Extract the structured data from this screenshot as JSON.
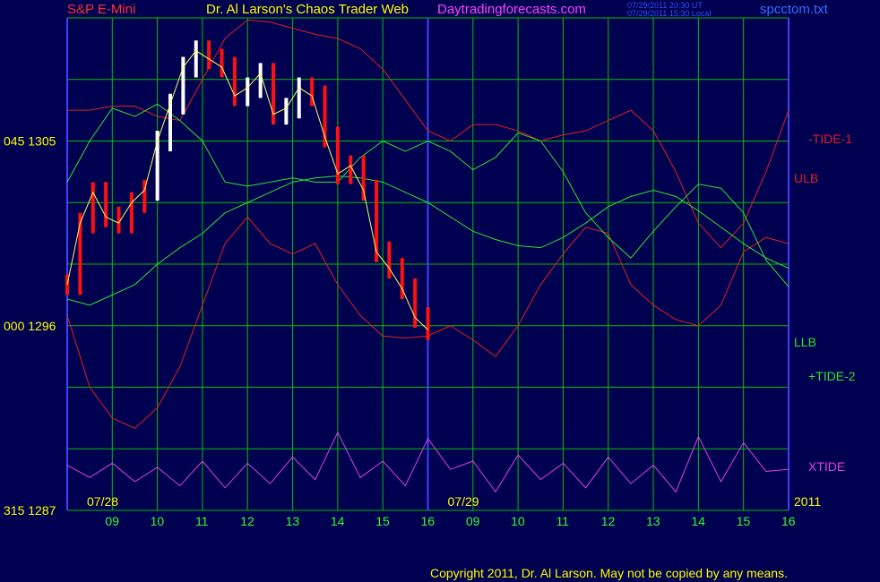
{
  "header": {
    "title": "S&P E-Mini",
    "subtitle": "Dr. Al Larson's Chaos Trader Web",
    "site": "Daytradingforecasts.com",
    "stamp_utc": "07/29/2011 20:30 UT",
    "stamp_local": "07/29/2011 15:30 Local",
    "file": "spcctom.txt"
  },
  "footer": {
    "copyright": "Copyright 2011, Dr. Al Larson. May not be copied by any means."
  },
  "colors": {
    "background": "#000050",
    "grid": "#00c000",
    "axis": "#4040ff",
    "tide1": "#e02020",
    "tide2": "#30e030",
    "xtide": "#e040e0",
    "bars": "#ff1010",
    "bars_up": "#ffffff",
    "average": "#ffff60",
    "blue_line": "#2030d0"
  },
  "chart_data": {
    "type": "line",
    "instrument": "S&P E-Mini",
    "ylim": [
      1287,
      1311
    ],
    "y_tick_labels": [
      {
        "code": "045",
        "price": 1305
      },
      {
        "code": "000",
        "price": 1296
      },
      {
        "code": "315",
        "price": 1287
      }
    ],
    "date_labels": [
      "07/28",
      "07/29"
    ],
    "year_label": "2011",
    "x_ticks": [
      "09",
      "10",
      "11",
      "12",
      "13",
      "14",
      "15",
      "16",
      "09",
      "10",
      "11",
      "12",
      "13",
      "14",
      "15",
      "16"
    ],
    "series_labels": {
      "tide1": "-TIDE-1",
      "ulb": "ULB",
      "llb": "LLB",
      "tide2": "+TIDE-2",
      "xtide": "XTIDE"
    },
    "x_hours": [
      8,
      8.5,
      9,
      9.5,
      10,
      10.5,
      11,
      11.5,
      12,
      12.5,
      13,
      13.5,
      14,
      14.5,
      15,
      15.5,
      16,
      16.5,
      17,
      17.5,
      18,
      18.5,
      19,
      19.5,
      20,
      20.5,
      21,
      21.5,
      22,
      22.5,
      23,
      23.5,
      24
    ],
    "tide1_upper": [
      1306.5,
      1306.5,
      1306.7,
      1306.7,
      1306.2,
      1306,
      1308,
      1310,
      1310.9,
      1310.8,
      1310.5,
      1310.2,
      1310,
      1309.5,
      1308.5,
      1307,
      1305.5,
      1305,
      1305.8,
      1305.8,
      1305.5,
      1305,
      1305.3,
      1305.5,
      1306,
      1306.5,
      1305.5,
      1303.5,
      1301,
      1299.8,
      1301,
      1303.5,
      1306.5
    ],
    "tide1_lower": [
      1296.5,
      1293,
      1291.5,
      1291,
      1292,
      1294,
      1297,
      1300,
      1301.3,
      1300,
      1299.5,
      1300,
      1298,
      1296.5,
      1295.5,
      1295.4,
      1295.5,
      1296,
      1295.3,
      1294.5,
      1296,
      1298,
      1299.5,
      1300.8,
      1300.5,
      1298,
      1297,
      1296.3,
      1296,
      1297,
      1299.6,
      1300.3,
      1300
    ],
    "tide2_upper": [
      1303,
      1305,
      1306.6,
      1306.2,
      1306.8,
      1306,
      1305,
      1303,
      1302.8,
      1303,
      1303.2,
      1303,
      1303,
      1304.2,
      1305,
      1304.5,
      1305,
      1304.5,
      1303.6,
      1304.2,
      1305.4,
      1305,
      1303.5,
      1301.5,
      1300.3,
      1299.3,
      1300.6,
      1301.8,
      1302.9,
      1302.7,
      1301.5,
      1299.2,
      1297.9
    ],
    "tide2_lower": [
      1297.3,
      1297,
      1297.5,
      1298,
      1299,
      1299.8,
      1300.5,
      1301.5,
      1302,
      1302.5,
      1303,
      1303.2,
      1303.3,
      1303.2,
      1303,
      1302.5,
      1302,
      1301.3,
      1300.6,
      1300.2,
      1299.9,
      1299.8,
      1300.3,
      1301,
      1301.8,
      1302.3,
      1302.6,
      1302.3,
      1301.6,
      1300.8,
      1300,
      1299.3,
      1298.8
    ],
    "price_bars_close": [
      1298,
      1301,
      1302.5,
      1301.3,
      1301,
      1302,
      1302.6,
      1305,
      1306.8,
      1308.6,
      1309.4,
      1309,
      1308.6,
      1307.2,
      1307.6,
      1308.3,
      1306.3,
      1306.6,
      1307.6,
      1307.2,
      1305.2,
      1303.4,
      1303.8,
      1302.6,
      1299.6,
      1298.8,
      1297.8,
      1296.4,
      1295.8
    ],
    "xtide_amplitude_note": "oscillating cycle line",
    "xtide": [
      1289.2,
      1288.6,
      1289.3,
      1288.4,
      1289.1,
      1288.2,
      1289.4,
      1288.1,
      1289.3,
      1288.3,
      1289.6,
      1288.5,
      1290.8,
      1288.6,
      1289.4,
      1288.2,
      1290.5,
      1289,
      1289.4,
      1287.9,
      1289.7,
      1288.5,
      1289.3,
      1288.1,
      1289.6,
      1288.3,
      1289.2,
      1287.9,
      1290.6,
      1288.4,
      1290.3,
      1288.9,
      1289
    ]
  }
}
